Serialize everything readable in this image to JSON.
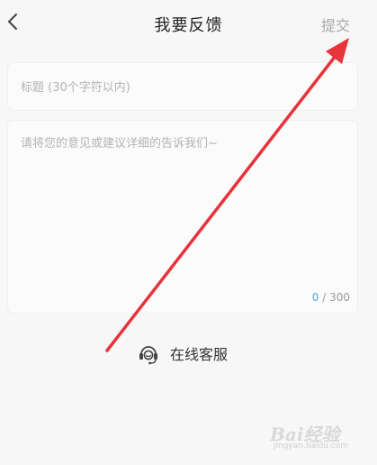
{
  "header": {
    "back_icon": "chevron-left-icon",
    "title": "我要反馈",
    "submit_label": "提交"
  },
  "form": {
    "title_placeholder": "标题 (30个字符以内)",
    "title_value": "",
    "content_placeholder": "请将您的意见或建议详细的告诉我们~",
    "content_value": "",
    "char_count_current": "0",
    "char_count_separator": " / ",
    "char_count_max": "300"
  },
  "service": {
    "icon": "headset-icon",
    "label": "在线客服"
  },
  "annotation": {
    "arrow_color": "#e8323c"
  },
  "watermark": {
    "brand": "Bai经验",
    "url": "jingyan.baidu.com"
  },
  "colors": {
    "background": "#f7f7f7",
    "counter_accent": "#5aa9e6",
    "submit_text": "#a8a8a8"
  }
}
